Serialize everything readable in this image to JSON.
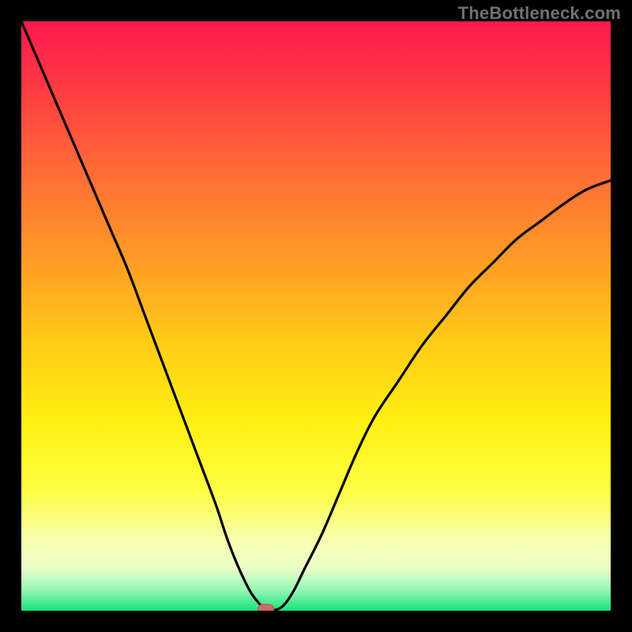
{
  "watermark": "TheBottleneck.com",
  "colors": {
    "bg": "#000000",
    "watermark": "#717171",
    "curve": "#000000",
    "marker_fill": "#cf6a66",
    "marker_stroke": "#b45451"
  },
  "gradient_stops": [
    {
      "offset": 0.0,
      "color": "#ff1a4e"
    },
    {
      "offset": 0.1,
      "color": "#ff3644"
    },
    {
      "offset": 0.25,
      "color": "#ff6a36"
    },
    {
      "offset": 0.4,
      "color": "#ff9a26"
    },
    {
      "offset": 0.55,
      "color": "#ffcd16"
    },
    {
      "offset": 0.68,
      "color": "#fff010"
    },
    {
      "offset": 0.8,
      "color": "#fdff45"
    },
    {
      "offset": 0.88,
      "color": "#faffb0"
    },
    {
      "offset": 0.93,
      "color": "#e8ffc9"
    },
    {
      "offset": 0.965,
      "color": "#94f7b6"
    },
    {
      "offset": 1.0,
      "color": "#18e47a"
    }
  ],
  "chart_data": {
    "type": "line",
    "title": "",
    "xlabel": "",
    "ylabel": "",
    "xlim": [
      0,
      100
    ],
    "ylim": [
      0,
      100
    ],
    "x": [
      0,
      3,
      6,
      9,
      12,
      15,
      18,
      21,
      24,
      27,
      30,
      33,
      35,
      37,
      39,
      41,
      41.5,
      44,
      46,
      48,
      51,
      54,
      57,
      60,
      64,
      68,
      72,
      76,
      80,
      84,
      88,
      92,
      96,
      100
    ],
    "y": [
      100,
      93,
      86,
      79,
      72,
      65,
      58,
      50,
      42,
      34,
      26,
      18,
      12,
      7,
      3,
      0.5,
      0,
      0.5,
      3,
      7,
      13,
      20,
      27,
      33,
      39,
      45,
      50,
      55,
      59,
      63,
      66,
      69,
      71.5,
      73
    ],
    "marker": {
      "x": 41.5,
      "y": 0
    }
  }
}
